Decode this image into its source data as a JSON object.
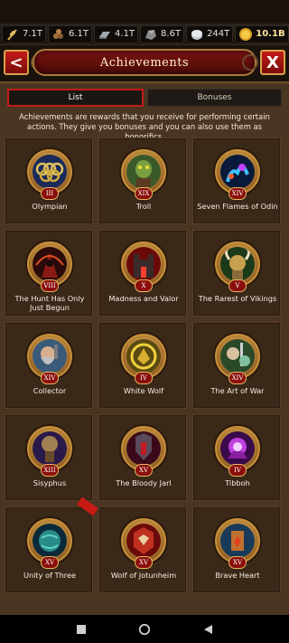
{
  "resources": [
    {
      "icon": "wheat-icon",
      "value": "7.1T"
    },
    {
      "icon": "wood-icon",
      "value": "6.1T"
    },
    {
      "icon": "iron-icon",
      "value": "4.1T"
    },
    {
      "icon": "stone-icon",
      "value": "8.6T"
    },
    {
      "icon": "silver-icon",
      "value": "244T"
    },
    {
      "icon": "gold-coin-icon",
      "value": "10.1B"
    }
  ],
  "header": {
    "title": "Achievements",
    "back_label": "<",
    "close_label": "X"
  },
  "tabs": [
    {
      "label": "List",
      "active": true
    },
    {
      "label": "Bonuses",
      "active": false
    }
  ],
  "description": "Achievements are rewards that you receive for performing certain actions. They give you bonuses and you can also use them as honorifics.",
  "achievements": [
    {
      "name": "Olympian",
      "rank": "III",
      "icon": "olympic-rings-icon"
    },
    {
      "name": "Troll",
      "rank": "XIX",
      "icon": "troll-icon"
    },
    {
      "name": "Seven Flames of Odin",
      "rank": "XIV",
      "icon": "flames-icon"
    },
    {
      "name": "The Hunt Has Only Just Begun",
      "rank": "VIII",
      "icon": "hooded-hunter-icon"
    },
    {
      "name": "Madness and Valor",
      "rank": "X",
      "icon": "fortress-icon"
    },
    {
      "name": "The Rarest of Vikings",
      "rank": "V",
      "icon": "viking-helmet-icon"
    },
    {
      "name": "Collector",
      "rank": "XIV",
      "icon": "dwarf-collector-icon"
    },
    {
      "name": "White Wolf",
      "rank": "IV",
      "icon": "wolf-icon"
    },
    {
      "name": "The Art of War",
      "rank": "XIV",
      "icon": "warrior-icon"
    },
    {
      "name": "Sisyphus",
      "rank": "XIII",
      "icon": "boulder-icon"
    },
    {
      "name": "The Bloody Jarl",
      "rank": "XV",
      "icon": "jarl-icon"
    },
    {
      "name": "Tibboh",
      "rank": "IV",
      "icon": "eye-icon"
    },
    {
      "name": "Unity of Three",
      "rank": "XV",
      "icon": "globe-icon"
    },
    {
      "name": "Wolf of Jotunheim",
      "rank": "XV",
      "icon": "armored-wolf-icon"
    },
    {
      "name": "Brave Heart",
      "rank": "XV",
      "icon": "brave-heart-icon"
    }
  ],
  "colors": {
    "accent_red": "#c21d18",
    "panel": "#4a3422",
    "gold": "#d8a24a"
  }
}
